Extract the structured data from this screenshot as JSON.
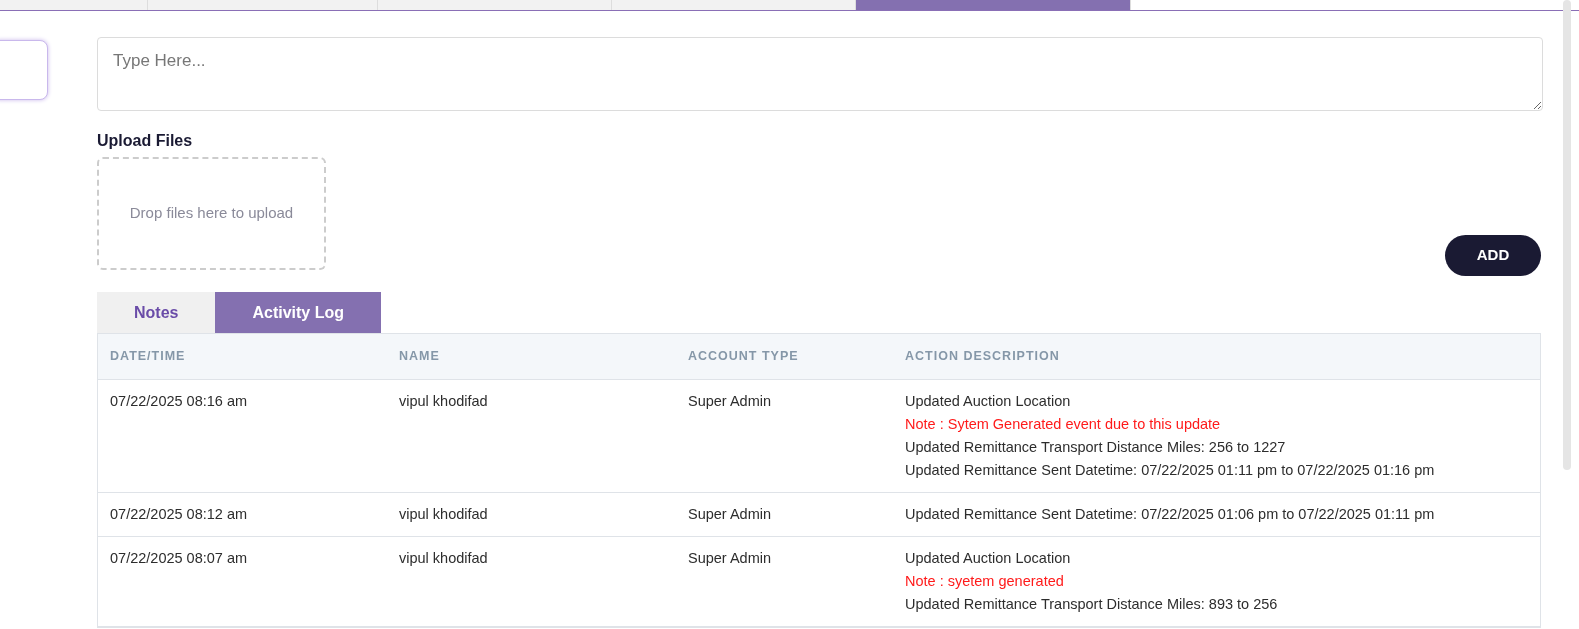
{
  "top_tabs": [
    {
      "selected": false
    },
    {
      "selected": false
    },
    {
      "selected": false
    },
    {
      "selected": false
    },
    {
      "selected": true
    }
  ],
  "note_field": {
    "placeholder": "Type Here..."
  },
  "upload": {
    "label": "Upload Files",
    "dropzone_text": "Drop files here to upload"
  },
  "add_button": "ADD",
  "log_tabs": [
    {
      "label": "Notes",
      "selected": false
    },
    {
      "label": "Activity Log",
      "selected": true
    }
  ],
  "table": {
    "columns": [
      "DATE/TIME",
      "NAME",
      "ACCOUNT TYPE",
      "ACTION DESCRIPTION"
    ],
    "rows": [
      {
        "datetime": "07/22/2025 08:16 am",
        "name": "vipul khodifad",
        "account_type": "Super Admin",
        "description": [
          {
            "kind": "text",
            "text": "Updated Auction Location"
          },
          {
            "kind": "note",
            "text": "Note : Sytem Generated event due to this update"
          },
          {
            "kind": "text",
            "text": "Updated Remittance Transport Distance Miles: 256 to 1227"
          },
          {
            "kind": "text",
            "text": "Updated Remittance Sent Datetime: 07/22/2025 01:11 pm to 07/22/2025 01:16 pm"
          }
        ]
      },
      {
        "datetime": "07/22/2025 08:12 am",
        "name": "vipul khodifad",
        "account_type": "Super Admin",
        "description": [
          {
            "kind": "text",
            "text": "Updated Remittance Sent Datetime: 07/22/2025 01:06 pm to 07/22/2025 01:11 pm"
          }
        ]
      },
      {
        "datetime": "07/22/2025 08:07 am",
        "name": "vipul khodifad",
        "account_type": "Super Admin",
        "description": [
          {
            "kind": "text",
            "text": "Updated Auction Location"
          },
          {
            "kind": "note",
            "text": "Note : syetem generated"
          },
          {
            "kind": "text",
            "text": "Updated Remittance Transport Distance Miles: 893 to 256"
          }
        ]
      }
    ]
  }
}
